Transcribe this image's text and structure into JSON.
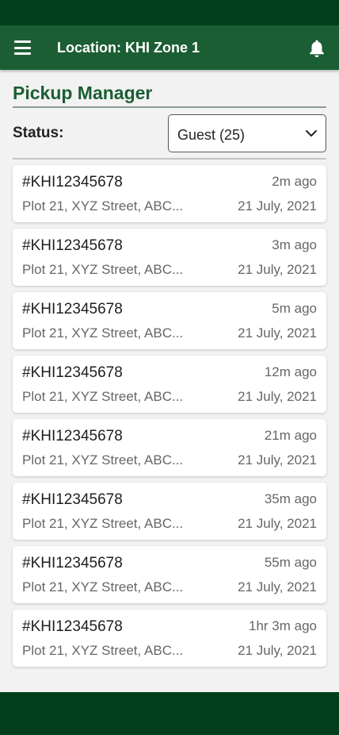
{
  "header": {
    "location_title": "Location: KHI Zone 1",
    "menu_icon": "hamburger-menu-icon",
    "notification_icon": "bell-icon"
  },
  "page": {
    "title": "Pickup Manager"
  },
  "filter": {
    "label": "Status:",
    "selected": "Guest (25)",
    "icon": "chevron-down-icon"
  },
  "pickups": [
    {
      "id": "#KHI12345678",
      "ago": "2m ago",
      "address": "Plot 21, XYZ Street, ABC...",
      "date": "21 July, 2021"
    },
    {
      "id": "#KHI12345678",
      "ago": "3m ago",
      "address": "Plot 21, XYZ Street, ABC...",
      "date": "21 July, 2021"
    },
    {
      "id": "#KHI12345678",
      "ago": "5m ago",
      "address": "Plot 21, XYZ Street, ABC...",
      "date": "21 July, 2021"
    },
    {
      "id": "#KHI12345678",
      "ago": "12m ago",
      "address": "Plot 21, XYZ Street, ABC...",
      "date": "21 July, 2021"
    },
    {
      "id": "#KHI12345678",
      "ago": "21m ago",
      "address": "Plot 21, XYZ Street, ABC...",
      "date": "21 July, 2021"
    },
    {
      "id": "#KHI12345678",
      "ago": "35m ago",
      "address": "Plot 21, XYZ Street, ABC...",
      "date": "21 July, 2021"
    },
    {
      "id": "#KHI12345678",
      "ago": "55m ago",
      "address": "Plot 21, XYZ Street, ABC...",
      "date": "21 July, 2021"
    },
    {
      "id": "#KHI12345678",
      "ago": "1hr 3m ago",
      "address": "Plot 21, XYZ Street, ABC...",
      "date": "21 July, 2021"
    }
  ],
  "colors": {
    "status_bar": "#003f19",
    "app_bar": "#1b5e33",
    "title": "#1b5e33",
    "background": "#f2f2f2"
  }
}
